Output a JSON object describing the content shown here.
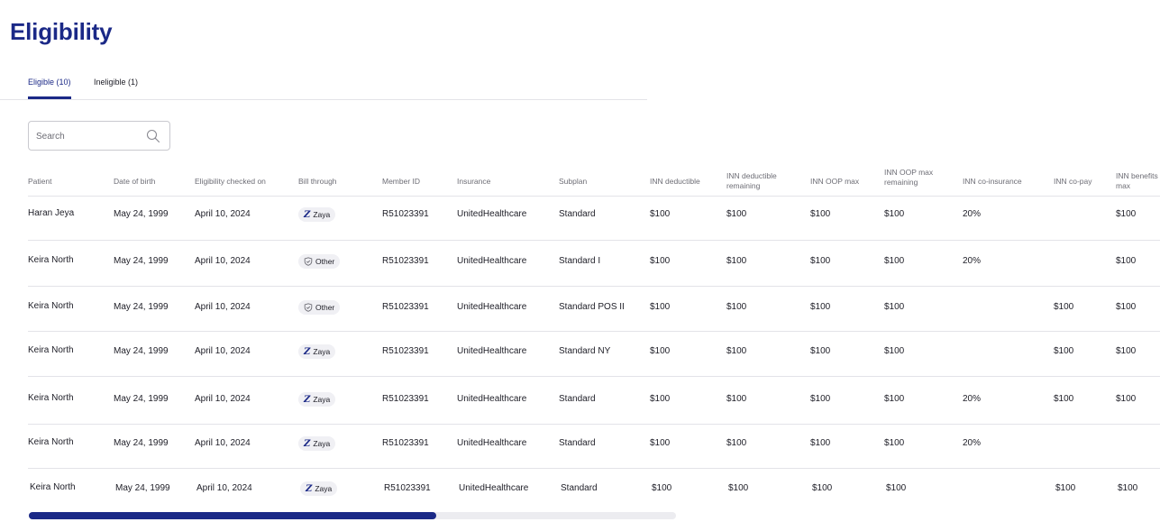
{
  "page": {
    "title": "Eligibility"
  },
  "tabs": [
    {
      "label": "Eligible (10)",
      "active": true
    },
    {
      "label": "Ineligible (1)",
      "active": false
    }
  ],
  "search": {
    "placeholder": "Search",
    "value": ""
  },
  "table": {
    "columns": [
      "Patient",
      "Date of birth",
      "Eligibility checked on",
      "Bill through",
      "Member ID",
      "Insurance",
      "Subplan",
      "INN deductible",
      "INN deductible remaining",
      "INN OOP max",
      "INN OOP max remaining",
      "INN co-insurance",
      "INN co-pay",
      "INN benefits max"
    ],
    "column_lines": {
      "inn_deductible_remaining": [
        "INN deductible",
        "remaining"
      ],
      "inn_oop_max_remaining": [
        "INN OOP max",
        "remaining"
      ],
      "inn_benefits_max": [
        "INN benefits",
        "max"
      ]
    },
    "rows": [
      {
        "patient": "Haran Jeya",
        "dob": "May 24, 1999",
        "checked": "April 10, 2024",
        "bill": "Zaya",
        "bill_icon": "zaya-icon",
        "member_id": "R51023391",
        "insurance": "UnitedHealthcare",
        "subplan": "Standard",
        "ded": "$100",
        "ded_rem": "$100",
        "oop": "$100",
        "oop_rem": "$100",
        "coins": "20%",
        "copay": "",
        "ben_max": "$100"
      },
      {
        "patient": "Keira North",
        "dob": "May 24, 1999",
        "checked": "April 10, 2024",
        "bill": "Other",
        "bill_icon": "shield-icon",
        "member_id": "R51023391",
        "insurance": "UnitedHealthcare",
        "subplan": "Standard I",
        "ded": "$100",
        "ded_rem": "$100",
        "oop": "$100",
        "oop_rem": "$100",
        "coins": "20%",
        "copay": "",
        "ben_max": "$100"
      },
      {
        "patient": "Keira North",
        "dob": "May 24, 1999",
        "checked": "April 10, 2024",
        "bill": "Other",
        "bill_icon": "shield-icon",
        "member_id": "R51023391",
        "insurance": "UnitedHealthcare",
        "subplan": "Standard POS II",
        "ded": "$100",
        "ded_rem": "$100",
        "oop": "$100",
        "oop_rem": "$100",
        "coins": "",
        "copay": "$100",
        "ben_max": "$100"
      },
      {
        "patient": "Keira North",
        "dob": "May 24, 1999",
        "checked": "April 10, 2024",
        "bill": "Zaya",
        "bill_icon": "zaya-icon",
        "member_id": "R51023391",
        "insurance": "UnitedHealthcare",
        "subplan": "Standard NY",
        "ded": "$100",
        "ded_rem": "$100",
        "oop": "$100",
        "oop_rem": "$100",
        "coins": "",
        "copay": "$100",
        "ben_max": "$100"
      },
      {
        "patient": "Keira North",
        "dob": "May 24, 1999",
        "checked": "April 10, 2024",
        "bill": "Zaya",
        "bill_icon": "zaya-icon",
        "member_id": "R51023391",
        "insurance": "UnitedHealthcare",
        "subplan": "Standard",
        "ded": "$100",
        "ded_rem": "$100",
        "oop": "$100",
        "oop_rem": "$100",
        "coins": "20%",
        "copay": "$100",
        "ben_max": "$100"
      },
      {
        "patient": "Keira North",
        "dob": "May 24, 1999",
        "checked": "April 10, 2024",
        "bill": "Zaya",
        "bill_icon": "zaya-icon",
        "member_id": "R51023391",
        "insurance": "UnitedHealthcare",
        "subplan": "Standard",
        "ded": "$100",
        "ded_rem": "$100",
        "oop": "$100",
        "oop_rem": "$100",
        "coins": "20%",
        "copay": "",
        "ben_max": ""
      },
      {
        "patient": "Keira North",
        "dob": "May 24, 1999",
        "checked": "April 10, 2024",
        "bill": "Zaya",
        "bill_icon": "zaya-icon",
        "member_id": "R51023391",
        "insurance": "UnitedHealthcare",
        "subplan": "Standard",
        "ded": "$100",
        "ded_rem": "$100",
        "oop": "$100",
        "oop_rem": "$100",
        "coins": "",
        "copay": "$100",
        "ben_max": "$100"
      }
    ]
  },
  "scrollbar": {
    "position_fraction": 0.63
  },
  "colors": {
    "accent": "#1b2987",
    "divider": "#e3e3e8",
    "badge_bg": "#f0f0f4"
  }
}
